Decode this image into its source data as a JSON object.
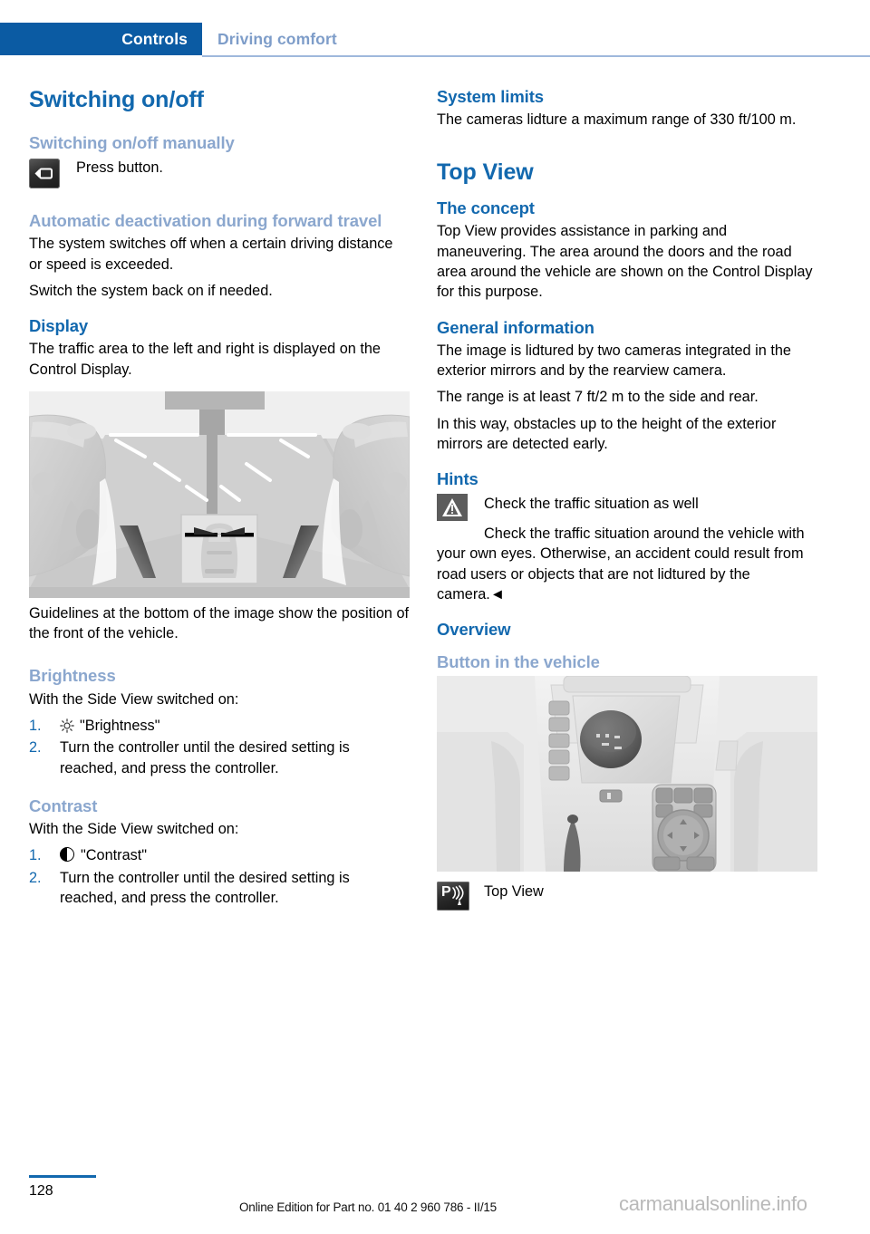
{
  "header": {
    "tab_label": "Controls",
    "section_label": "Driving comfort"
  },
  "left_column": {
    "heading_switching": "Switching on/off",
    "sub_manual": "Switching on/off manually",
    "press_button_text": "Press button.",
    "press_button_icon": "camera-button-icon",
    "sub_auto_deactivation": "Automatic deactivation during forward travel",
    "auto_p1": "The system switches off when a certain driving distance or speed is exceeded.",
    "auto_p2": "Switch the system back on if needed.",
    "heading_display": "Display",
    "display_p1": "The traffic area to the left and right is displayed on the Control Display.",
    "figure_sideview_alt": "side-view-camera-display-illustration",
    "display_p2": "Guidelines at the bottom of the image show the position of the front of the vehicle.",
    "heading_brightness": "Brightness",
    "brightness_intro": "With the Side View switched on:",
    "brightness_steps": [
      {
        "num": "1.",
        "icon": "sun-icon",
        "text": "\"Brightness\""
      },
      {
        "num": "2.",
        "icon": "",
        "text": "Turn the controller until the desired setting is reached, and press the controller."
      }
    ],
    "heading_contrast": "Contrast",
    "contrast_intro": "With the Side View switched on:",
    "contrast_steps": [
      {
        "num": "1.",
        "icon": "half-circle-icon",
        "text": "\"Contrast\""
      },
      {
        "num": "2.",
        "icon": "",
        "text": "Turn the controller until the desired setting is reached, and press the controller."
      }
    ]
  },
  "right_column": {
    "heading_system_limits": "System limits",
    "system_limits_p1": "The cameras lidture a maximum range of 330 ft/100 m.",
    "chapter_top_view": "Top View",
    "heading_concept": "The concept",
    "concept_p1": "Top View provides assistance in parking and maneuvering. The area around the doors and the road area around the vehicle are shown on the Control Display for this purpose.",
    "heading_general_info": "General information",
    "general_p1": "The image is lidtured by two cameras integrated in the exterior mirrors and by the rearview camera.",
    "general_p2": "The range is at least 7 ft/2 m to the side and rear.",
    "general_p3": "In this way, obstacles up to the height of the exterior mirrors are detected early.",
    "heading_hints": "Hints",
    "warning_icon": "warning-triangle-icon",
    "warning_title": "Check the traffic situation as well",
    "warning_body": "Check the traffic situation around the vehicle with your own eyes. Otherwise, an accident could result from road users or objects that are not lidtured by the camera.◄",
    "heading_overview": "Overview",
    "sub_button_vehicle": "Button in the vehicle",
    "figure_console_alt": "center-console-photo",
    "caption_icon": "pdc-top-view-icon",
    "caption_text": "Top View"
  },
  "footer": {
    "page_number": "128",
    "edition": "Online Edition for Part no. 01 40 2 960 786 - II/15",
    "watermark": "carmanualsonline.info"
  },
  "colors": {
    "header_blue": "#0B5BA3",
    "heading_blue": "#1268AE",
    "subheading_blue": "#8BA7CE",
    "rule_blue": "#9FB8DC"
  }
}
